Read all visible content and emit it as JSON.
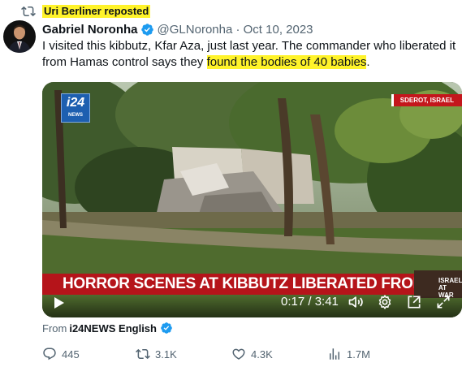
{
  "repost": {
    "text": "Uri Berliner reposted",
    "icon": "repost-icon"
  },
  "tweet": {
    "author_name": "Gabriel Noronha",
    "meta": "@GLNoronha · Oct 10, 2023",
    "text_before": "I visited this kibbutz, Kfar Aza, just last  year. The commander who liberated it from Hamas control says they ",
    "text_highlight": "found the bodies of 40 babies",
    "text_after": "."
  },
  "video": {
    "logo_big": "i24",
    "logo_small": "NEWS",
    "location": "SDEROT, ISRAEL",
    "ticker": "HORROR SCENES AT KIBBUTZ LIBERATED FROM HAMAS",
    "war_label_1": "ISRAEL",
    "war_label_2": "AT WAR",
    "time": "0:17 / 3:41",
    "progress_fraction": 0.077
  },
  "source": {
    "from": "From",
    "account": "i24NEWS English"
  },
  "actions": {
    "replies": "445",
    "reposts": "3.1K",
    "likes": "4.3K",
    "views": "1.7M"
  },
  "colors": {
    "highlight": "#fff32a",
    "verified": "#1d9bf0",
    "ticker": "#b5141a",
    "muted": "#536471"
  }
}
